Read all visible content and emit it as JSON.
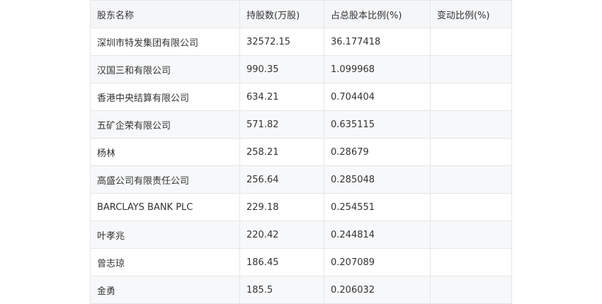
{
  "table": {
    "headers": [
      "股东名称",
      "持股数(万股)",
      "占总股本比例(%)",
      "变动比例(%)"
    ],
    "rows": [
      [
        "深圳市特发集团有限公司",
        "32572.15",
        "36.177418",
        ""
      ],
      [
        "汉国三和有限公司",
        "990.35",
        "1.099968",
        ""
      ],
      [
        "香港中央结算有限公司",
        "634.21",
        "0.704404",
        ""
      ],
      [
        "五矿企荣有限公司",
        "571.82",
        "0.635115",
        ""
      ],
      [
        "杨林",
        "258.21",
        "0.28679",
        ""
      ],
      [
        "高盛公司有限责任公司",
        "256.64",
        "0.285048",
        ""
      ],
      [
        "BARCLAYS BANK PLC",
        "229.18",
        "0.254551",
        ""
      ],
      [
        "叶孝兆",
        "220.42",
        "0.244814",
        ""
      ],
      [
        "曾志琼",
        "186.45",
        "0.207089",
        ""
      ],
      [
        "金勇",
        "185.5",
        "0.206032",
        ""
      ]
    ]
  }
}
